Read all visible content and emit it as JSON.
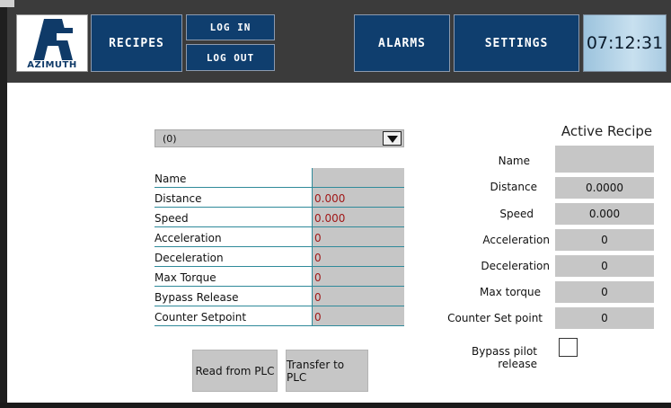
{
  "header": {
    "logo_text": "AZIMUTH",
    "recipes_label": "RECIPES",
    "login_label": "LOG IN",
    "logout_label": "LOG OUT",
    "alarms_label": "ALARMS",
    "settings_label": "SETTINGS",
    "clock": "07:12:31"
  },
  "editor": {
    "selected_recipe": "(0)",
    "rows": [
      {
        "label": "Name",
        "value": ""
      },
      {
        "label": "Distance",
        "value": "0.000"
      },
      {
        "label": "Speed",
        "value": "0.000"
      },
      {
        "label": "Acceleration",
        "value": "0"
      },
      {
        "label": "Deceleration",
        "value": "0"
      },
      {
        "label": "Max Torque",
        "value": "0"
      },
      {
        "label": "Bypass Release",
        "value": "0"
      },
      {
        "label": "Counter Setpoint",
        "value": "0"
      }
    ],
    "read_button": "Read from PLC",
    "transfer_button": "Transfer to PLC"
  },
  "active": {
    "title": "Active Recipe",
    "name_label": "Name",
    "name_value": "",
    "distance_label": "Distance",
    "distance_value": "0.0000",
    "speed_label": "Speed",
    "speed_value": "0.000",
    "acceleration_label": "Acceleration",
    "acceleration_value": "0",
    "deceleration_label": "Deceleration",
    "deceleration_value": "0",
    "max_torque_label": "Max torque",
    "max_torque_value": "0",
    "counter_label": "Counter Set point",
    "counter_value": "0",
    "bypass_label": "Bypass pilot release",
    "bypass_checked": false
  },
  "colors": {
    "nav_button": "#0f3e6e",
    "topbar": "#3b3b3b",
    "field_bg": "#c6c6c6",
    "value_text": "#a01818",
    "row_divider": "#2f8a9a"
  }
}
